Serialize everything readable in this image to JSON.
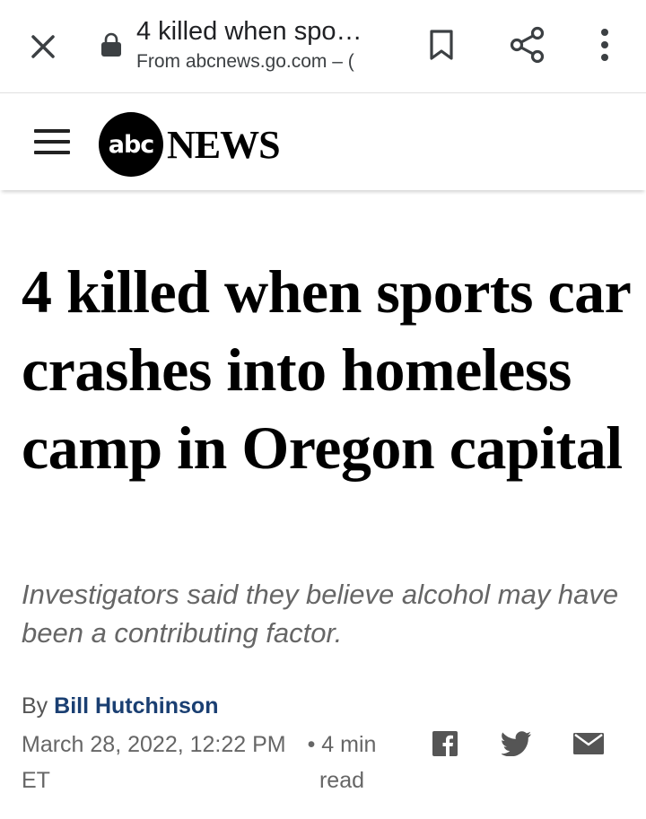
{
  "browser": {
    "tab_title": "4 killed when spo…",
    "origin": "From abcnews.go.com – ("
  },
  "site": {
    "logo_mark": "abc",
    "logo_text": "NEWS"
  },
  "article": {
    "headline": "4 killed when sports car crashes into homeless camp in Oregon capital",
    "dek": "Investigators said they believe alcohol may have been a contributing factor.",
    "byline_prefix": "By",
    "author": "Bill Hutchinson",
    "date": "March 28, 2022, 12:22 PM ET",
    "read_time": "• 4 min read"
  },
  "icons": {
    "close": "close-icon",
    "lock": "lock-icon",
    "bookmark": "bookmark-icon",
    "share": "share-icon",
    "more": "more-vertical-icon",
    "menu": "hamburger-menu-icon",
    "facebook": "facebook-icon",
    "twitter": "twitter-icon",
    "email": "email-icon"
  },
  "colors": {
    "author_link": "#1a3f72",
    "dek_gray": "#666666",
    "icon_gray": "#555555"
  }
}
